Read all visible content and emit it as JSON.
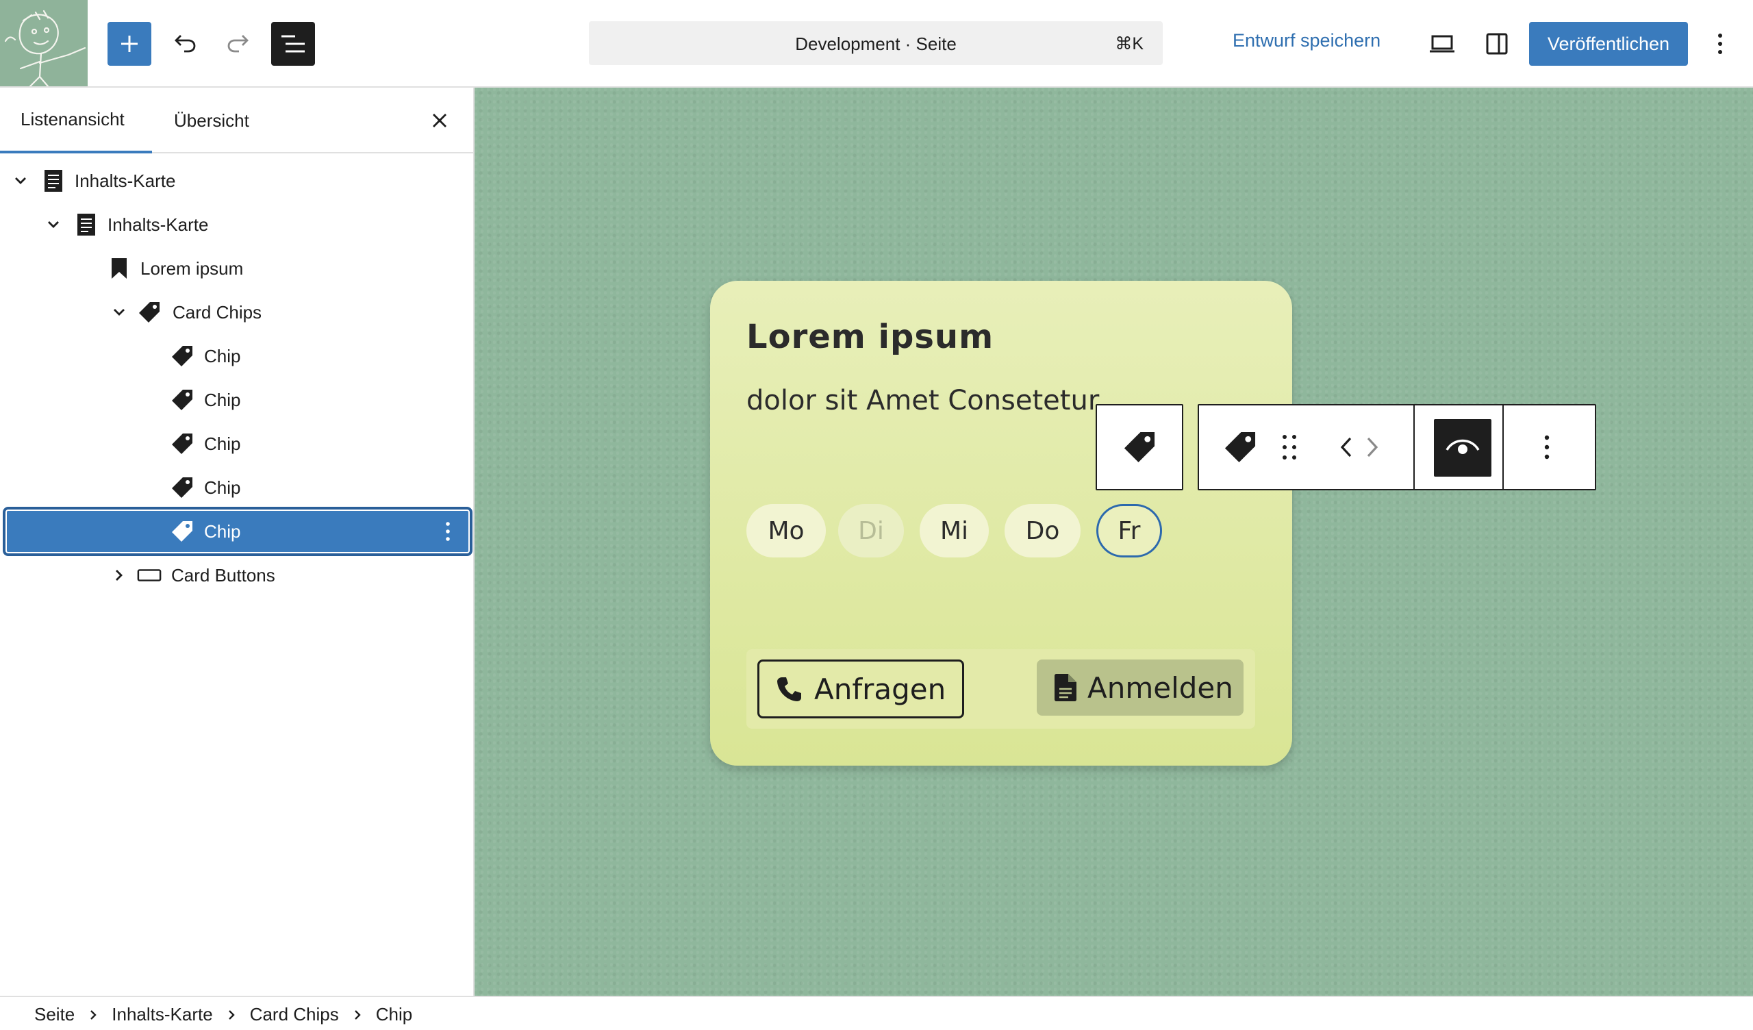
{
  "header": {
    "add_label": "",
    "command_title": "Development · Seite",
    "command_shortcut": "⌘K",
    "save_draft": "Entwurf speichern",
    "publish": "Veröffentlichen"
  },
  "sidebar": {
    "tabs": [
      {
        "label": "Listenansicht",
        "active": true
      },
      {
        "label": "Übersicht",
        "active": false
      }
    ],
    "tree": [
      {
        "label": "Inhalts-Karte",
        "icon": "document-icon",
        "expanded": true
      },
      {
        "label": "Inhalts-Karte",
        "icon": "document-icon",
        "expanded": true
      },
      {
        "label": "Lorem ipsum",
        "icon": "bookmark-icon"
      },
      {
        "label": "Card Chips",
        "icon": "tag-icon",
        "expanded": true
      },
      {
        "label": "Chip",
        "icon": "tag-icon"
      },
      {
        "label": "Chip",
        "icon": "tag-icon"
      },
      {
        "label": "Chip",
        "icon": "tag-icon"
      },
      {
        "label": "Chip",
        "icon": "tag-icon"
      },
      {
        "label": "Chip",
        "icon": "tag-icon",
        "selected": true
      },
      {
        "label": "Card Buttons",
        "icon": "button-icon",
        "expanded": false
      }
    ]
  },
  "card": {
    "title": "Lorem ipsum",
    "text": "dolor sit Amet Consetetur",
    "chips": [
      {
        "label": "Mo",
        "state": "normal"
      },
      {
        "label": "Di",
        "state": "muted"
      },
      {
        "label": "Mi",
        "state": "normal"
      },
      {
        "label": "Do",
        "state": "normal"
      },
      {
        "label": "Fr",
        "state": "active"
      }
    ],
    "buttons": {
      "anfragen": "Anfragen",
      "anmelden": "Anmelden"
    }
  },
  "breadcrumb": [
    "Seite",
    "Inhalts-Karte",
    "Card Chips",
    "Chip"
  ],
  "colors": {
    "accent": "#3a7bbd",
    "canvas": "#8fb79c",
    "card": "#e3eaa9",
    "chip_active_border": "#2c69ad"
  }
}
